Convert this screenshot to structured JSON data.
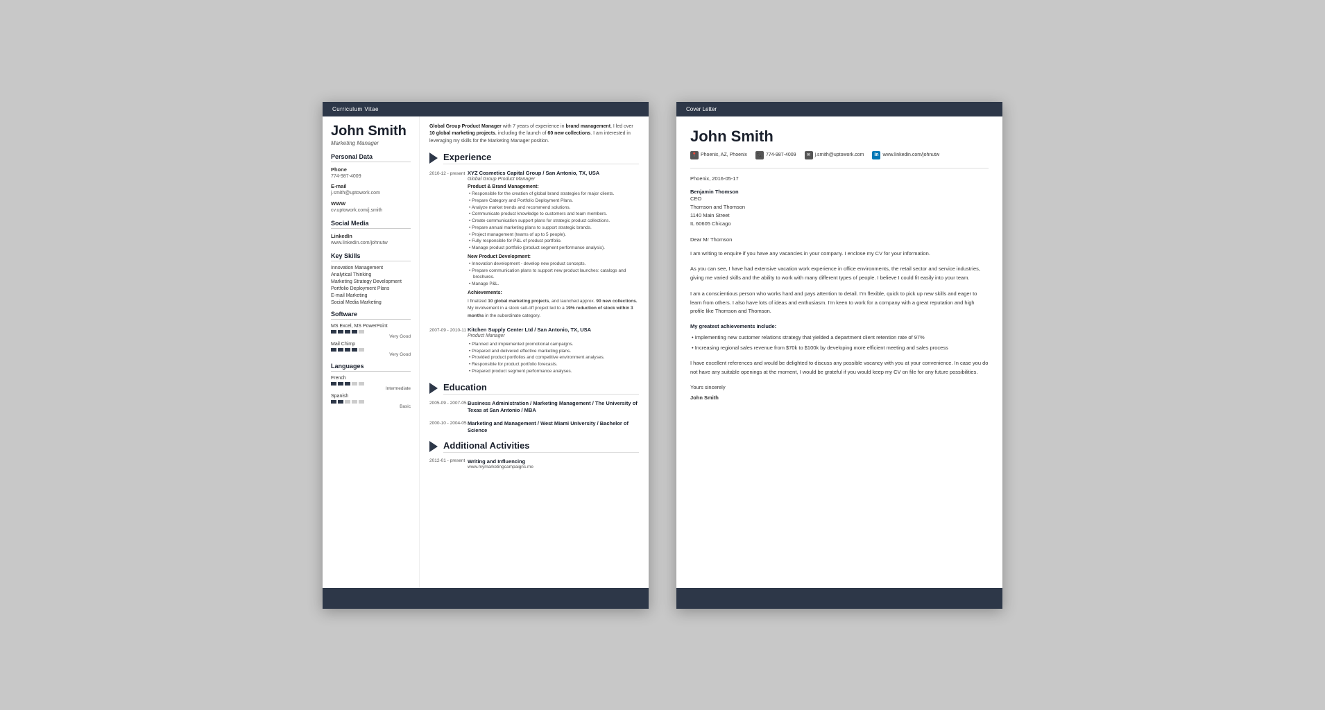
{
  "cv": {
    "header": "Curriculum Vitae",
    "name": "John Smith",
    "title": "Marketing Manager",
    "personal_data": {
      "section_title": "Personal Data",
      "phone_label": "Phone",
      "phone_value": "774-987-4009",
      "email_label": "E-mail",
      "email_value": "j.smith@uptowork.com",
      "www_label": "WWW",
      "www_value": "cv.uptowork.com/j.smith"
    },
    "social_media": {
      "section_title": "Social Media",
      "linkedin_label": "LinkedIn",
      "linkedin_value": "www.linkedin.com/johnutw"
    },
    "key_skills": {
      "section_title": "Key Skills",
      "skills": [
        "Innovation Management",
        "Analytical Thinking",
        "Marketing Strategy Development",
        "Portfolio Deployment Plans",
        "E-mail Marketing",
        "Social Media Marketing"
      ]
    },
    "software": {
      "section_title": "Software",
      "items": [
        {
          "name": "MS Excel, MS PowerPoint",
          "rating": 4,
          "max": 5,
          "label": "Very Good"
        },
        {
          "name": "Mail Chimp",
          "rating": 4,
          "max": 5,
          "label": "Very Good"
        }
      ]
    },
    "languages": {
      "section_title": "Languages",
      "items": [
        {
          "name": "French",
          "rating": 3,
          "max": 5,
          "label": "Intermediate"
        },
        {
          "name": "Spanish",
          "rating": 2,
          "max": 5,
          "label": "Basic"
        }
      ]
    },
    "summary": "Global Group Product Manager with 7 years of experience in brand management, I led over 10 global marketing projects, including the launch of 60 new collections. I am interested in leveraging my skills for the Marketing Manager position.",
    "experience": {
      "section_title": "Experience",
      "items": [
        {
          "date": "2010-12 - present",
          "company": "XYZ Cosmetics Capital Group / San Antonio, TX, USA",
          "role": "Global Group Product Manager",
          "sections": [
            {
              "subtitle": "Product & Brand Management:",
              "bullets": [
                "Responsible for the creation of global brand strategies for major clients.",
                "Prepare Category and Portfolio Deployment Plans.",
                "Analyze market trends and recommend solutions.",
                "Communicate product knowledge to customers and team members.",
                "Create communication support plans for strategic product collections.",
                "Prepare annual marketing plans to support strategic brands.",
                "Project management (teams of up to 5 people).",
                "Fully responsible for P&L of product portfolio.",
                "Manage product portfolio (product segment performance analysis)."
              ]
            },
            {
              "subtitle": "New Product Development:",
              "bullets": [
                "Innovation development - develop new product concepts.",
                "Prepare communication plans to support new product launches: catalogs and brochures.",
                "Manage P&L."
              ]
            },
            {
              "subtitle": "Achievements:",
              "achievement_text": "I finalized 10 global marketing projects, and launched approx. 90 new collections.\nMy involvement in a stock sell-off project led to a 19% reduction of stock within 3 months in the subordinate category."
            }
          ]
        },
        {
          "date": "2007-09 - 2010-11",
          "company": "Kitchen Supply Center Ltd / San Antonio, TX, USA",
          "role": "Product Manager",
          "bullets": [
            "Planned and implemented promotional campaigns.",
            "Prepared and delivered effective marketing plans.",
            "Provided product portfolios and competitive environment analyses.",
            "Responsible for product portfolio forecasts.",
            "Prepared product segment performance analyses."
          ]
        }
      ]
    },
    "education": {
      "section_title": "Education",
      "items": [
        {
          "date": "2005-09 - 2007-05",
          "degree": "Business Administration / Marketing Management / The University of Texas at San Antonio / MBA"
        },
        {
          "date": "2000-10 - 2004-05",
          "degree": "Marketing and Management / West Miami University / Bachelor of Science"
        }
      ]
    },
    "activities": {
      "section_title": "Additional Activities",
      "items": [
        {
          "date": "2012-01 - present",
          "title": "Writing and Influencing",
          "detail": "www.mymarketingcampaigns.me"
        }
      ]
    }
  },
  "cover": {
    "header": "Cover Letter",
    "name": "John Smith",
    "contact": {
      "location": "Phoenix, AZ, Phoenix",
      "phone": "774-987-4009",
      "email": "j.smith@uptowork.com",
      "linkedin": "www.linkedin.com/johnutw"
    },
    "date": "Phoenix, 2016-05-17",
    "recipient": {
      "name": "Benjamin Thomson",
      "title": "CEO",
      "company": "Thomson and Thomson",
      "address": "1140 Main Street",
      "city": "IL 60605 Chicago"
    },
    "salutation": "Dear Mr Thomson",
    "paragraphs": [
      "I am writing to enquire if you have any vacancies in your company. I enclose my CV for your information.",
      "As you can see, I have had extensive vacation work experience in office environments, the retail sector and service industries, giving me varied skills and the ability to work with many different types of people. I believe I could fit easily into your team.",
      "I am a conscientious person who works hard and pays attention to detail. I'm flexible, quick to pick up new skills and eager to learn from others. I also have lots of ideas and enthusiasm. I'm keen to work for a company with a great reputation and high profile like Thomson and Thomson."
    ],
    "achievements_title": "My greatest achievements include:",
    "achievements": [
      "Implementing new customer relations strategy that yielded a department client retention rate of 97%",
      "Increasing regional sales revenue from $70k to $100k by developing more efficient meeting and sales process"
    ],
    "closing_para": "I have excellent references and would be delighted to discuss any possible vacancy with you at your convenience. In case you do not have any suitable openings at the moment, I would be grateful if you would keep my CV on file for any future possibilities.",
    "yours": "Yours sincerely",
    "signature": "John Smith"
  }
}
